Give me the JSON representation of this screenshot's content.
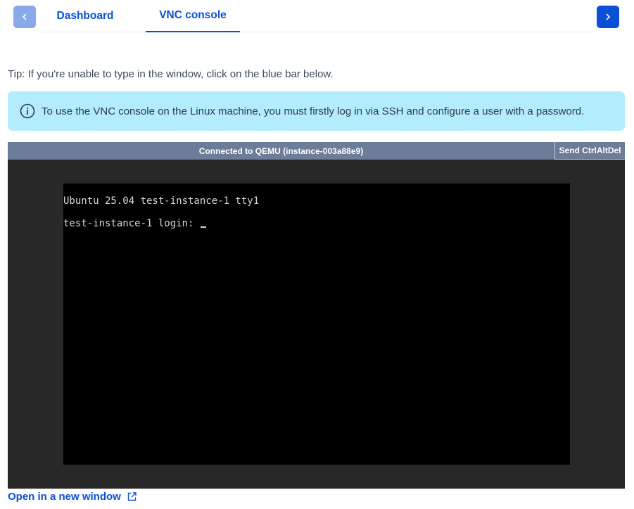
{
  "tabs": {
    "items": [
      {
        "label": "Dashboard",
        "active": false
      },
      {
        "label": "VNC console",
        "active": true
      }
    ],
    "prev_icon": "chevron-left-icon",
    "next_icon": "chevron-right-icon"
  },
  "tip": {
    "text": "Tip: If you're unable to type in the window, click on the blue bar below."
  },
  "alert": {
    "icon": "info-icon",
    "text": "To use the VNC console on the Linux machine, you must firstly log in via SSH and configure a user with a password."
  },
  "vnc": {
    "status": "Connected to QEMU (instance-003a88e9)",
    "ctrl_alt_del_label": "Send CtrlAltDel",
    "terminal_lines": [
      "Ubuntu 25.04 test-instance-1 tty1",
      "test-instance-1 login: "
    ]
  },
  "footer": {
    "open_link_label": "Open in a new window",
    "open_link_icon": "external-link-icon"
  },
  "colors": {
    "accent": "#0b4fd6",
    "alert_bg": "#b3ecfb",
    "vnc_bar": "#6b7d99",
    "vnc_bg": "#282828"
  }
}
